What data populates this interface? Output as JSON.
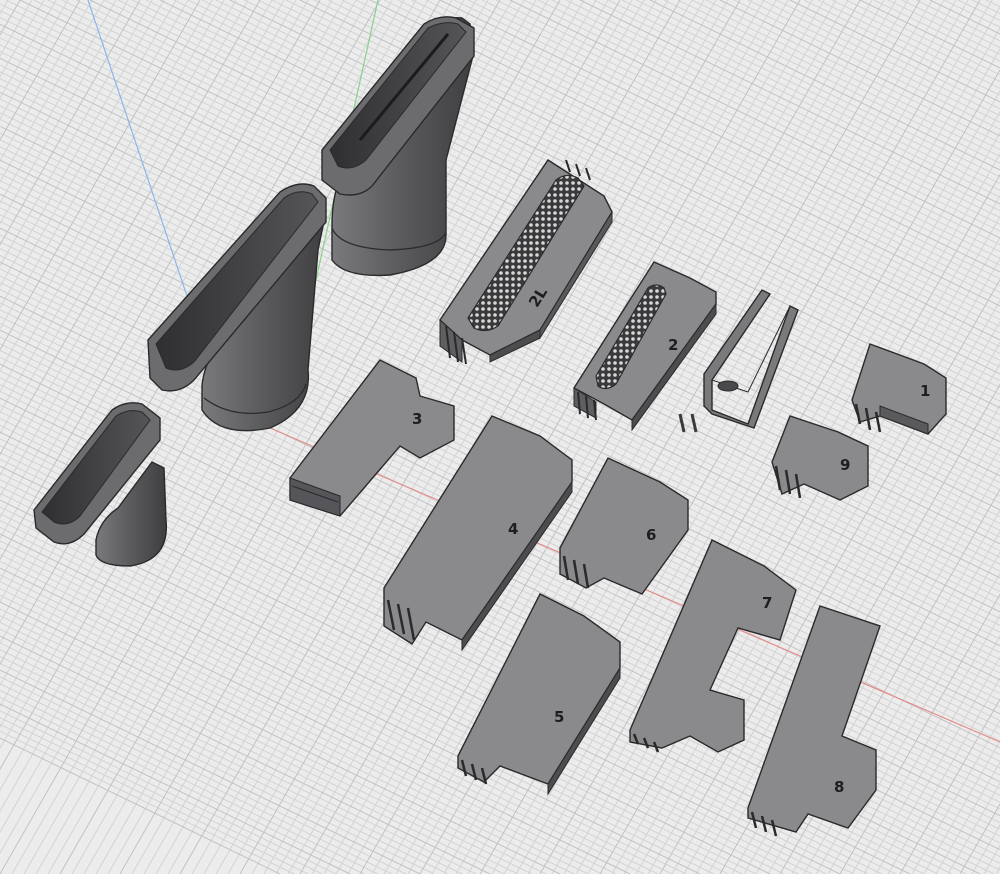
{
  "viewport": {
    "background": "#ececec",
    "grid_color": "#cfcfcf",
    "axes": {
      "x_axis_color": "#e58a8a",
      "y_axis_color": "#8ad18a",
      "z_axis_color": "#8ab8e8"
    }
  },
  "models": {
    "nozzle_large": {
      "color": "#5e5e60"
    },
    "nozzle_medium": {
      "color": "#5e5e60"
    },
    "nozzle_small": {
      "color": "#5e5e60"
    },
    "u_bracket": {
      "color": "#6a6a6c"
    },
    "pins": {
      "color": "#6a6a6c"
    }
  },
  "labels": {
    "piece_2l": "2L",
    "piece_2": "2",
    "piece_1": "1",
    "piece_9": "9",
    "piece_3": "3",
    "piece_4": "4",
    "piece_6": "6",
    "piece_7": "7",
    "piece_5": "5",
    "piece_8": "8"
  }
}
